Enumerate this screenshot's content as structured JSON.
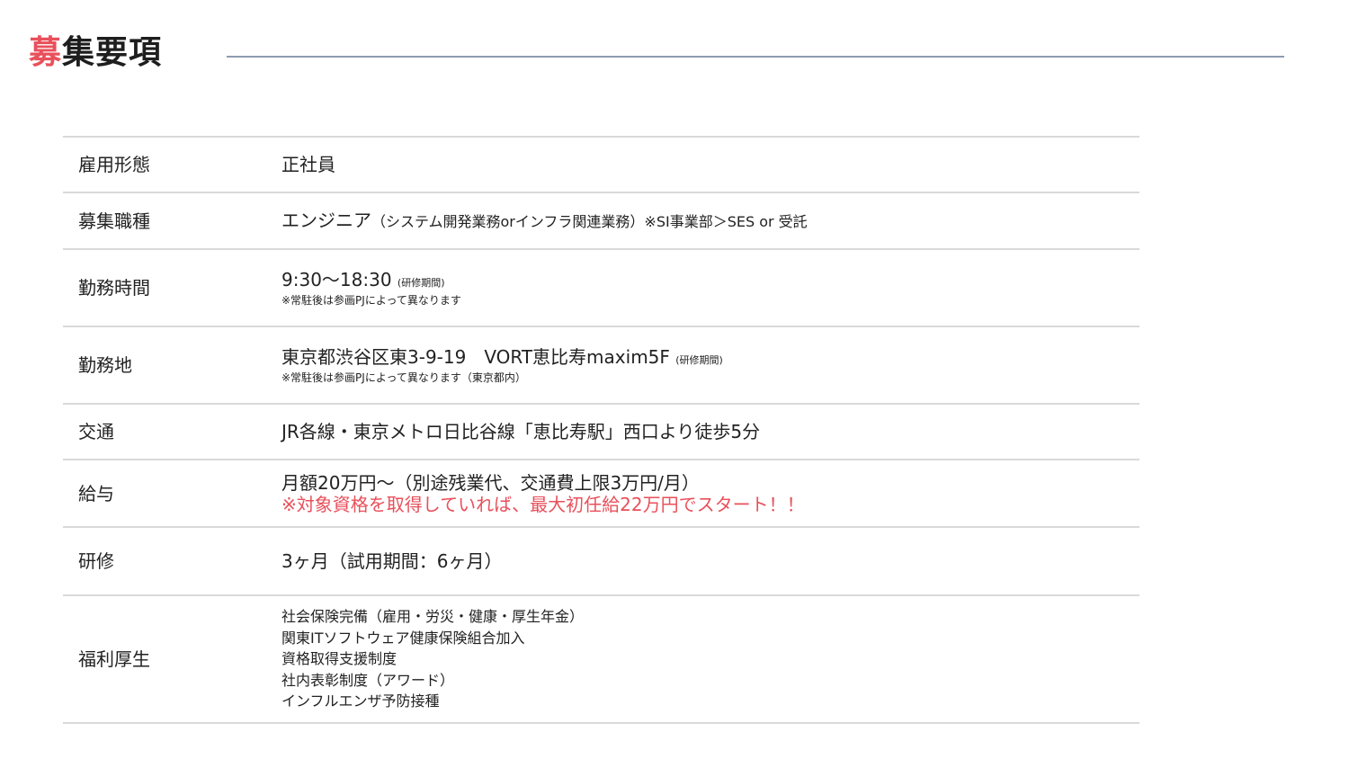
{
  "header": {
    "title_accent": "募",
    "title_rest": "集要項"
  },
  "rows": [
    {
      "label": "雇用形態",
      "value": "正社員"
    },
    {
      "label": "募集職種",
      "value": "エンジニア",
      "note": "（システム開発業務orインフラ関連業務）※SI事業部＞SES or 受託"
    },
    {
      "label": "勤務時間",
      "value": "9:30〜18:30",
      "note": "(研修期間)",
      "sub": "※常駐後は参画PJによって異なります"
    },
    {
      "label": "勤務地",
      "value": "東京都渋谷区東3-9-19　VORT恵比寿maxim5F",
      "note": "(研修期間)",
      "sub": "※常駐後は参画PJによって異なります（東京都内）"
    },
    {
      "label": "交通",
      "value": "JR各線・東京メトロ日比谷線「恵比寿駅」西口より徒歩5分"
    },
    {
      "label": "給与",
      "value": "月額20万円〜（別途残業代、交通費上限3万円/月）",
      "highlight": "※対象資格を取得していれば、最大初任給22万円でスタート！！"
    },
    {
      "label": "研修",
      "value": "3ヶ月（試用期間：6ヶ月）"
    },
    {
      "label": "福利厚生",
      "items": [
        "社会保険完備（雇用・労災・健康・厚生年金）",
        "関東ITソフトウェア健康保険組合加入",
        "資格取得支援制度",
        "社内表彰制度（アワード）",
        "インフルエンザ予防接種"
      ]
    }
  ],
  "colors": {
    "accent": "#e8505b",
    "rule": "#8f9bb0",
    "border": "#d9d9d9"
  }
}
